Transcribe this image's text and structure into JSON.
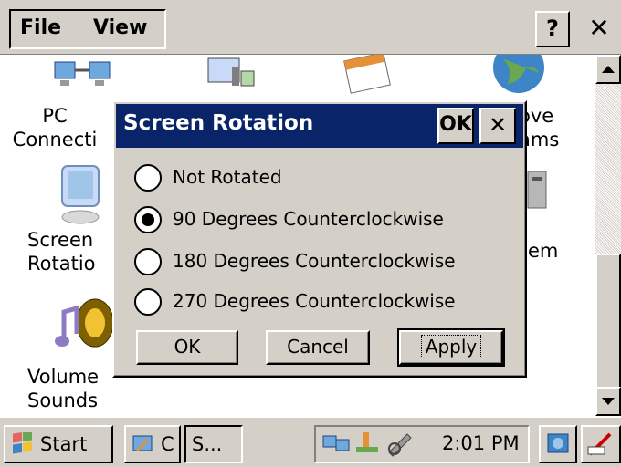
{
  "menubar": {
    "file_label": "File",
    "view_label": "View",
    "help_label": "?",
    "close_label": "✕"
  },
  "control_panel": {
    "items": [
      {
        "label_line1": "PC",
        "label_line2": "Connecti"
      },
      {
        "label_line1": "Screen",
        "label_line2": "Rotatio"
      },
      {
        "label_line1": "Volume",
        "label_line2": "Sounds"
      },
      {
        "label_line1": "ove",
        "label_line2": "ams"
      },
      {
        "label_line1": "em",
        "label_line2": ""
      }
    ]
  },
  "dialog": {
    "title": "Screen Rotation",
    "ok_title_label": "OK",
    "close_label": "✕",
    "options": [
      {
        "label": "Not Rotated",
        "checked": false
      },
      {
        "label": "90 Degrees Counterclockwise",
        "checked": true
      },
      {
        "label": "180 Degrees Counterclockwise",
        "checked": false
      },
      {
        "label": "270 Degrees Counterclockwise",
        "checked": false
      }
    ],
    "ok_button": "OK",
    "cancel_button": "Cancel",
    "apply_button": "Apply"
  },
  "taskbar": {
    "start_label": "Start",
    "task1_label": "C",
    "task2_label": "S...",
    "clock": "2:01 PM"
  },
  "colors": {
    "title_bar": "#0a246a",
    "face": "#d4d0c8"
  }
}
